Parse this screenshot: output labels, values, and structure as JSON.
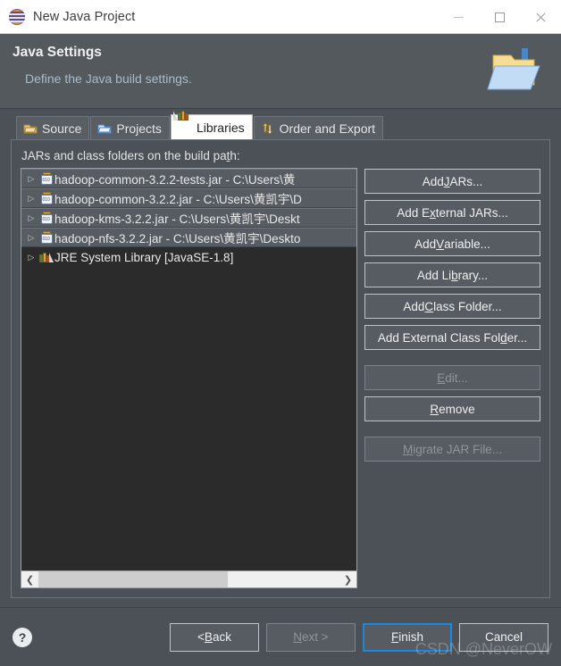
{
  "window": {
    "title": "New Java Project",
    "logo_icon": "eclipse-logo-icon",
    "minimize_label": "Minimize",
    "maximize_label": "Maximize",
    "close_label": "Close"
  },
  "header": {
    "title": "Java Settings",
    "description": "Define the Java build settings.",
    "icon": "java-project-folder-icon"
  },
  "tabs": [
    {
      "label": "Source",
      "icon": "source-folder-icon",
      "active": false
    },
    {
      "label": "Projects",
      "icon": "open-folder-icon",
      "active": false
    },
    {
      "label": "Libraries",
      "icon": "libraries-books-icon",
      "active": true
    },
    {
      "label": "Order and Export",
      "icon": "order-export-icon",
      "active": false
    }
  ],
  "panel": {
    "list_label_pre": "JARs and class folders on the build pa",
    "list_label_mnemonic": "t",
    "list_label_post": "h:"
  },
  "list": {
    "items": [
      {
        "text": "hadoop-common-3.2.2-tests.jar - C:\\Users\\黄",
        "icon": "jar-icon",
        "type": "jar"
      },
      {
        "text": "hadoop-common-3.2.2.jar - C:\\Users\\黄凯宇\\D",
        "icon": "jar-icon",
        "type": "jar"
      },
      {
        "text": "hadoop-kms-3.2.2.jar - C:\\Users\\黄凯宇\\Deskt",
        "icon": "jar-icon",
        "type": "jar"
      },
      {
        "text": "hadoop-nfs-3.2.2.jar - C:\\Users\\黄凯宇\\Deskto",
        "icon": "jar-icon",
        "type": "jar"
      },
      {
        "text": "JRE System Library [JavaSE-1.8]",
        "icon": "libraries-books-icon",
        "type": "library"
      }
    ],
    "expand_arrow": "▷",
    "scroll_left_icon": "❮",
    "scroll_right_icon": "❯"
  },
  "buttons": [
    {
      "pre": "Add ",
      "mn": "J",
      "post": "ARs...",
      "disabled": false,
      "gap": false
    },
    {
      "pre": "Add E",
      "mn": "x",
      "post": "ternal JARs...",
      "disabled": false,
      "gap": false
    },
    {
      "pre": "Add ",
      "mn": "V",
      "post": "ariable...",
      "disabled": false,
      "gap": false
    },
    {
      "pre": "Add Li",
      "mn": "b",
      "post": "rary...",
      "disabled": false,
      "gap": false
    },
    {
      "pre": "Add ",
      "mn": "C",
      "post": "lass Folder...",
      "disabled": false,
      "gap": false
    },
    {
      "pre": "Add External Class Fol",
      "mn": "d",
      "post": "er...",
      "disabled": false,
      "gap": false
    },
    {
      "pre": "",
      "mn": "E",
      "post": "dit...",
      "disabled": true,
      "gap": true
    },
    {
      "pre": "",
      "mn": "R",
      "post": "emove",
      "disabled": false,
      "gap": false
    },
    {
      "pre": "",
      "mn": "M",
      "post": "igrate JAR File...",
      "disabled": true,
      "gap": true
    }
  ],
  "footer": {
    "help_icon": "help-question-icon",
    "help_glyph": "?",
    "buttons": [
      {
        "pre": "< ",
        "mn": "B",
        "post": "ack",
        "disabled": false,
        "focused": false
      },
      {
        "pre": "",
        "mn": "N",
        "post": "ext >",
        "disabled": true,
        "focused": false
      },
      {
        "pre": "",
        "mn": "F",
        "post": "inish",
        "disabled": false,
        "focused": true
      },
      {
        "pre": "Cancel",
        "mn": "",
        "post": "",
        "disabled": false,
        "focused": false
      }
    ],
    "watermark": "CSDN @NeverOW"
  },
  "colors": {
    "dialog_bg": "#4b5156",
    "header_bg": "#54595e",
    "titlebar_bg": "#ffffff",
    "list_bg": "#2b2b2b",
    "row_bg": "#565c62",
    "accent_focus": "#1a88e0",
    "desc_text": "#a8bcc8"
  }
}
